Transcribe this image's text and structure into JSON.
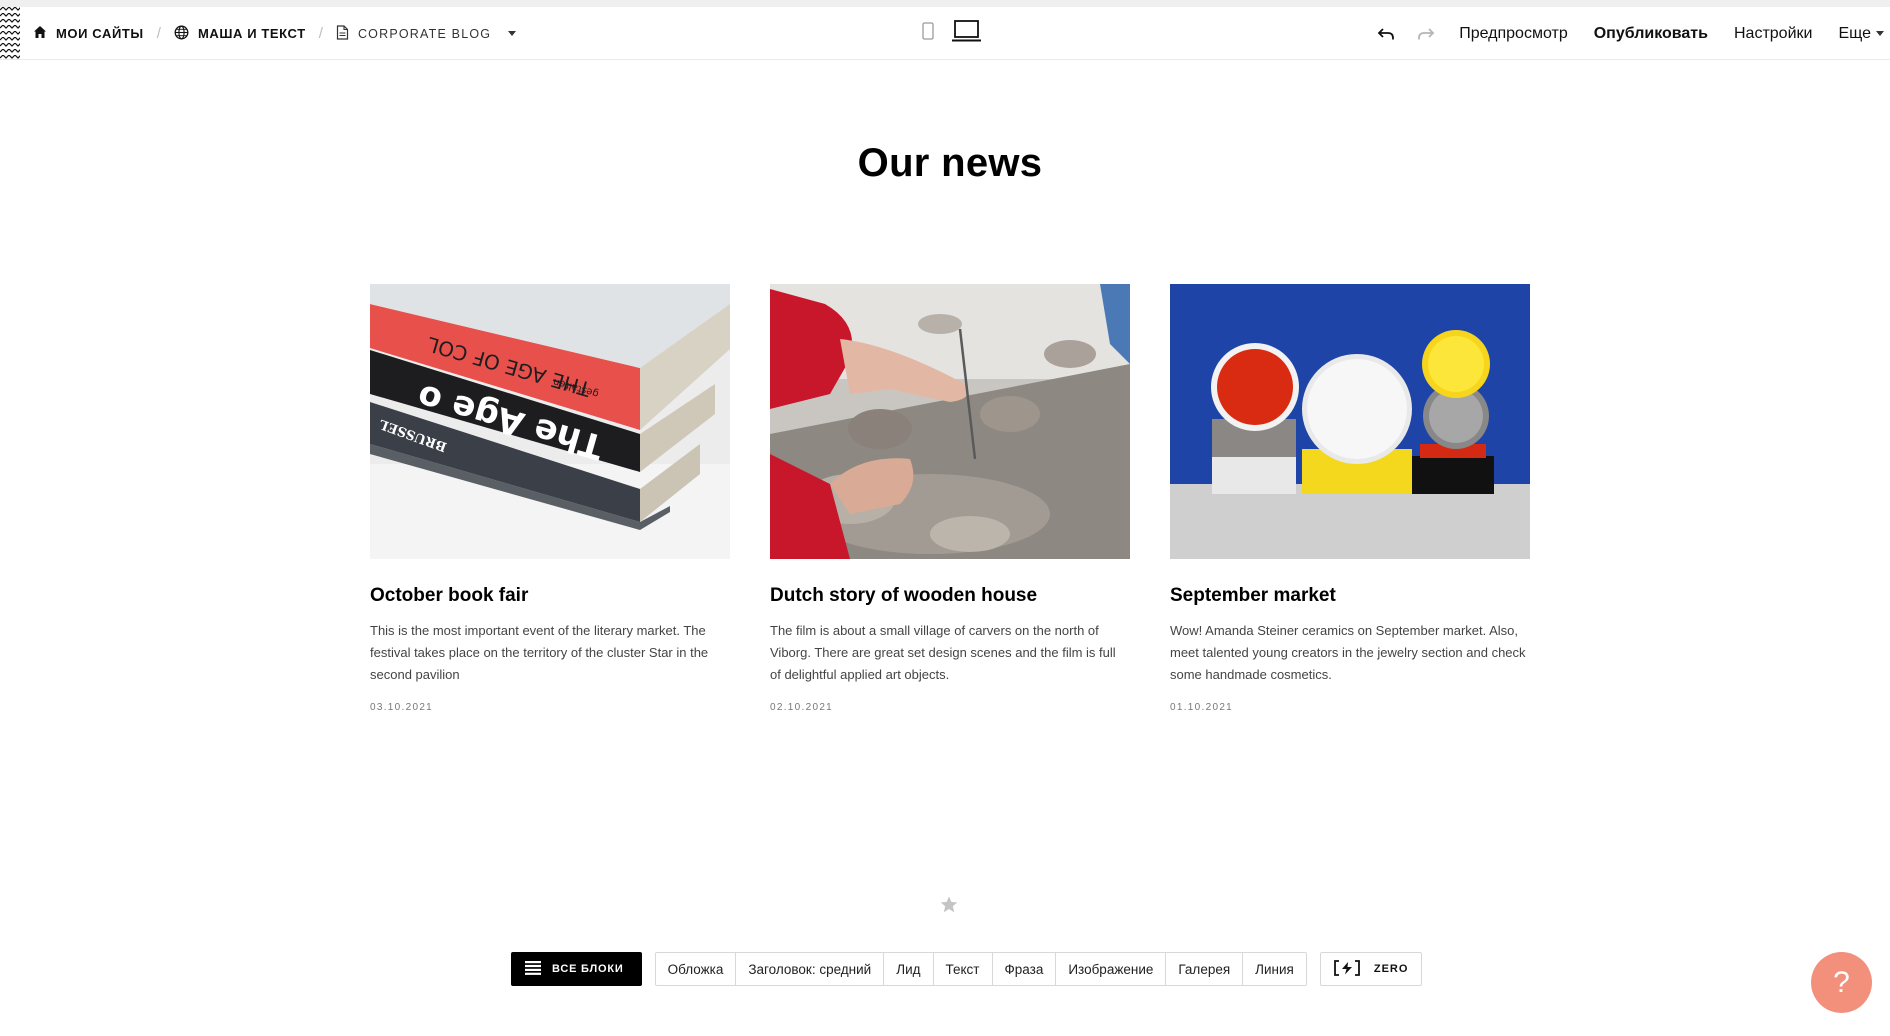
{
  "topbar": {
    "breadcrumbs": [
      {
        "label": "МОИ САЙТЫ",
        "icon": "home-icon"
      },
      {
        "label": "МАША И ТЕКСТ",
        "icon": "globe-icon"
      },
      {
        "label": "CORPORATE BLOG",
        "icon": "page-icon"
      }
    ],
    "devices": [
      {
        "name": "mobile",
        "icon": "phone-icon",
        "active": false
      },
      {
        "name": "desktop",
        "icon": "laptop-icon",
        "active": true
      }
    ],
    "preview_label": "Предпросмотр",
    "publish_label": "Опубликовать",
    "settings_label": "Настройки",
    "more_label": "Еще"
  },
  "page": {
    "title": "Our news",
    "cards": [
      {
        "title": "October book fair",
        "text": "This is the most important event of the literary market. The festival takes place on the territory of the cluster Star in the second pavilion",
        "date": "03.10.2021",
        "image_text": [
          "THE AGE OF COL",
          "The Age o",
          "BRUSSEL",
          "gestalten"
        ]
      },
      {
        "title": "Dutch story of wooden house",
        "text": "The film is about a small village of carvers on the north of Viborg. There are great set design scenes and the film is full of delightful applied art objects.",
        "date": "02.10.2021"
      },
      {
        "title": "September market",
        "text": "Wow! Amanda Steiner ceramics on September market. Also, meet talented young creators in the jewelry section and check some handmade cosmetics.",
        "date": "01.10.2021"
      }
    ]
  },
  "blocks_panel": {
    "all_blocks_label": "ВСЕ БЛОКИ",
    "chips": [
      "Обложка",
      "Заголовок: средний",
      "Лид",
      "Текст",
      "Фраза",
      "Изображение",
      "Галерея",
      "Линия"
    ],
    "zero_label": "ZERO"
  },
  "help": {
    "label": "?"
  },
  "colors": {
    "accent": "#f3907b",
    "button_dark": "#000000"
  }
}
